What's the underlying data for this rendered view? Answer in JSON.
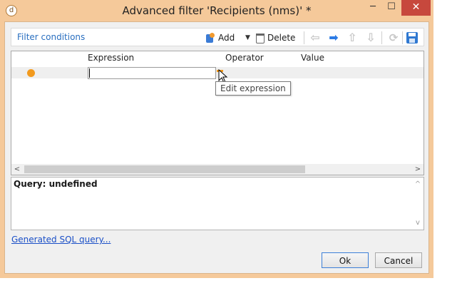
{
  "window": {
    "title": "Advanced filter 'Recipients (nms)' *",
    "app_icon_glyph": "d",
    "minimize_glyph": "─",
    "maximize_glyph": "☐",
    "close_glyph": "✕"
  },
  "toolbar": {
    "filter_conditions_label": "Filter conditions",
    "add_label": "Add",
    "add_dropdown_glyph": "▼",
    "delete_label": "Delete",
    "nav_left_glyph": "⇦",
    "nav_right_glyph": "➡",
    "nav_up_glyph": "⇧",
    "nav_down_glyph": "⇩",
    "refresh_glyph": "⟳"
  },
  "grid": {
    "columns": [
      "Expression",
      "Operator",
      "Value"
    ],
    "rows": [
      {
        "expression": "",
        "operator": "",
        "value": ""
      }
    ],
    "scroll_left_glyph": "<",
    "scroll_right_glyph": ">"
  },
  "tooltip": {
    "text": "Edit expression"
  },
  "query": {
    "text": "Query: undefined",
    "scroll_up_glyph": "^",
    "scroll_down_glyph": "v"
  },
  "links": {
    "generated_sql": "Generated SQL query..."
  },
  "buttons": {
    "ok": "Ok",
    "cancel": "Cancel"
  },
  "colors": {
    "frame": "#f5c99a",
    "close_button": "#c7483d",
    "row_marker": "#f29a1e",
    "accent_blue": "#2c7be5",
    "link": "#1a4fc7"
  }
}
